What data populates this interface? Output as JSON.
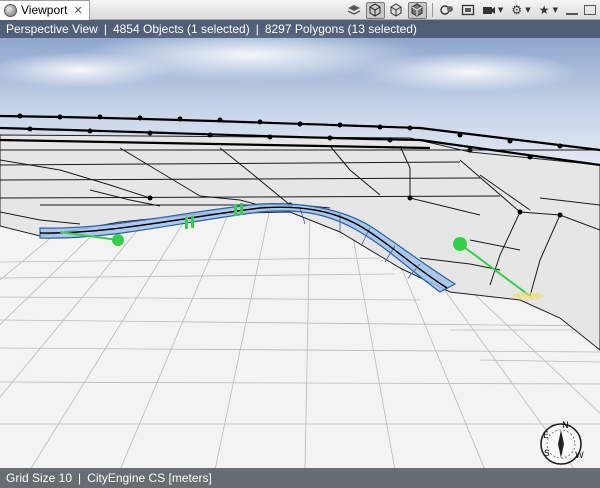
{
  "tab": {
    "title": "Viewport",
    "close_glyph": "✕"
  },
  "toolbar": {
    "icons": [
      "layers-icon",
      "wireframe-icon",
      "shaded-icon",
      "textured-icon",
      "bookmark-camera-icon",
      "frame-icon",
      "camera-icon",
      "settings-icon",
      "star-icon"
    ]
  },
  "info": {
    "view_name": "Perspective View",
    "objects": "4854 Objects  (1 selected)",
    "polygons": "8297 Polygons  (13 selected)"
  },
  "status": {
    "grid": "Grid Size 10",
    "cs": "CityEngine CS [meters]"
  },
  "compass": {
    "n": "N",
    "e": "E",
    "s": "S",
    "w": "W"
  },
  "colors": {
    "selection": "#9fc3ea",
    "handle": "#35d04a",
    "sky_top": "#8fa8cf",
    "terrain": "#ececec"
  }
}
